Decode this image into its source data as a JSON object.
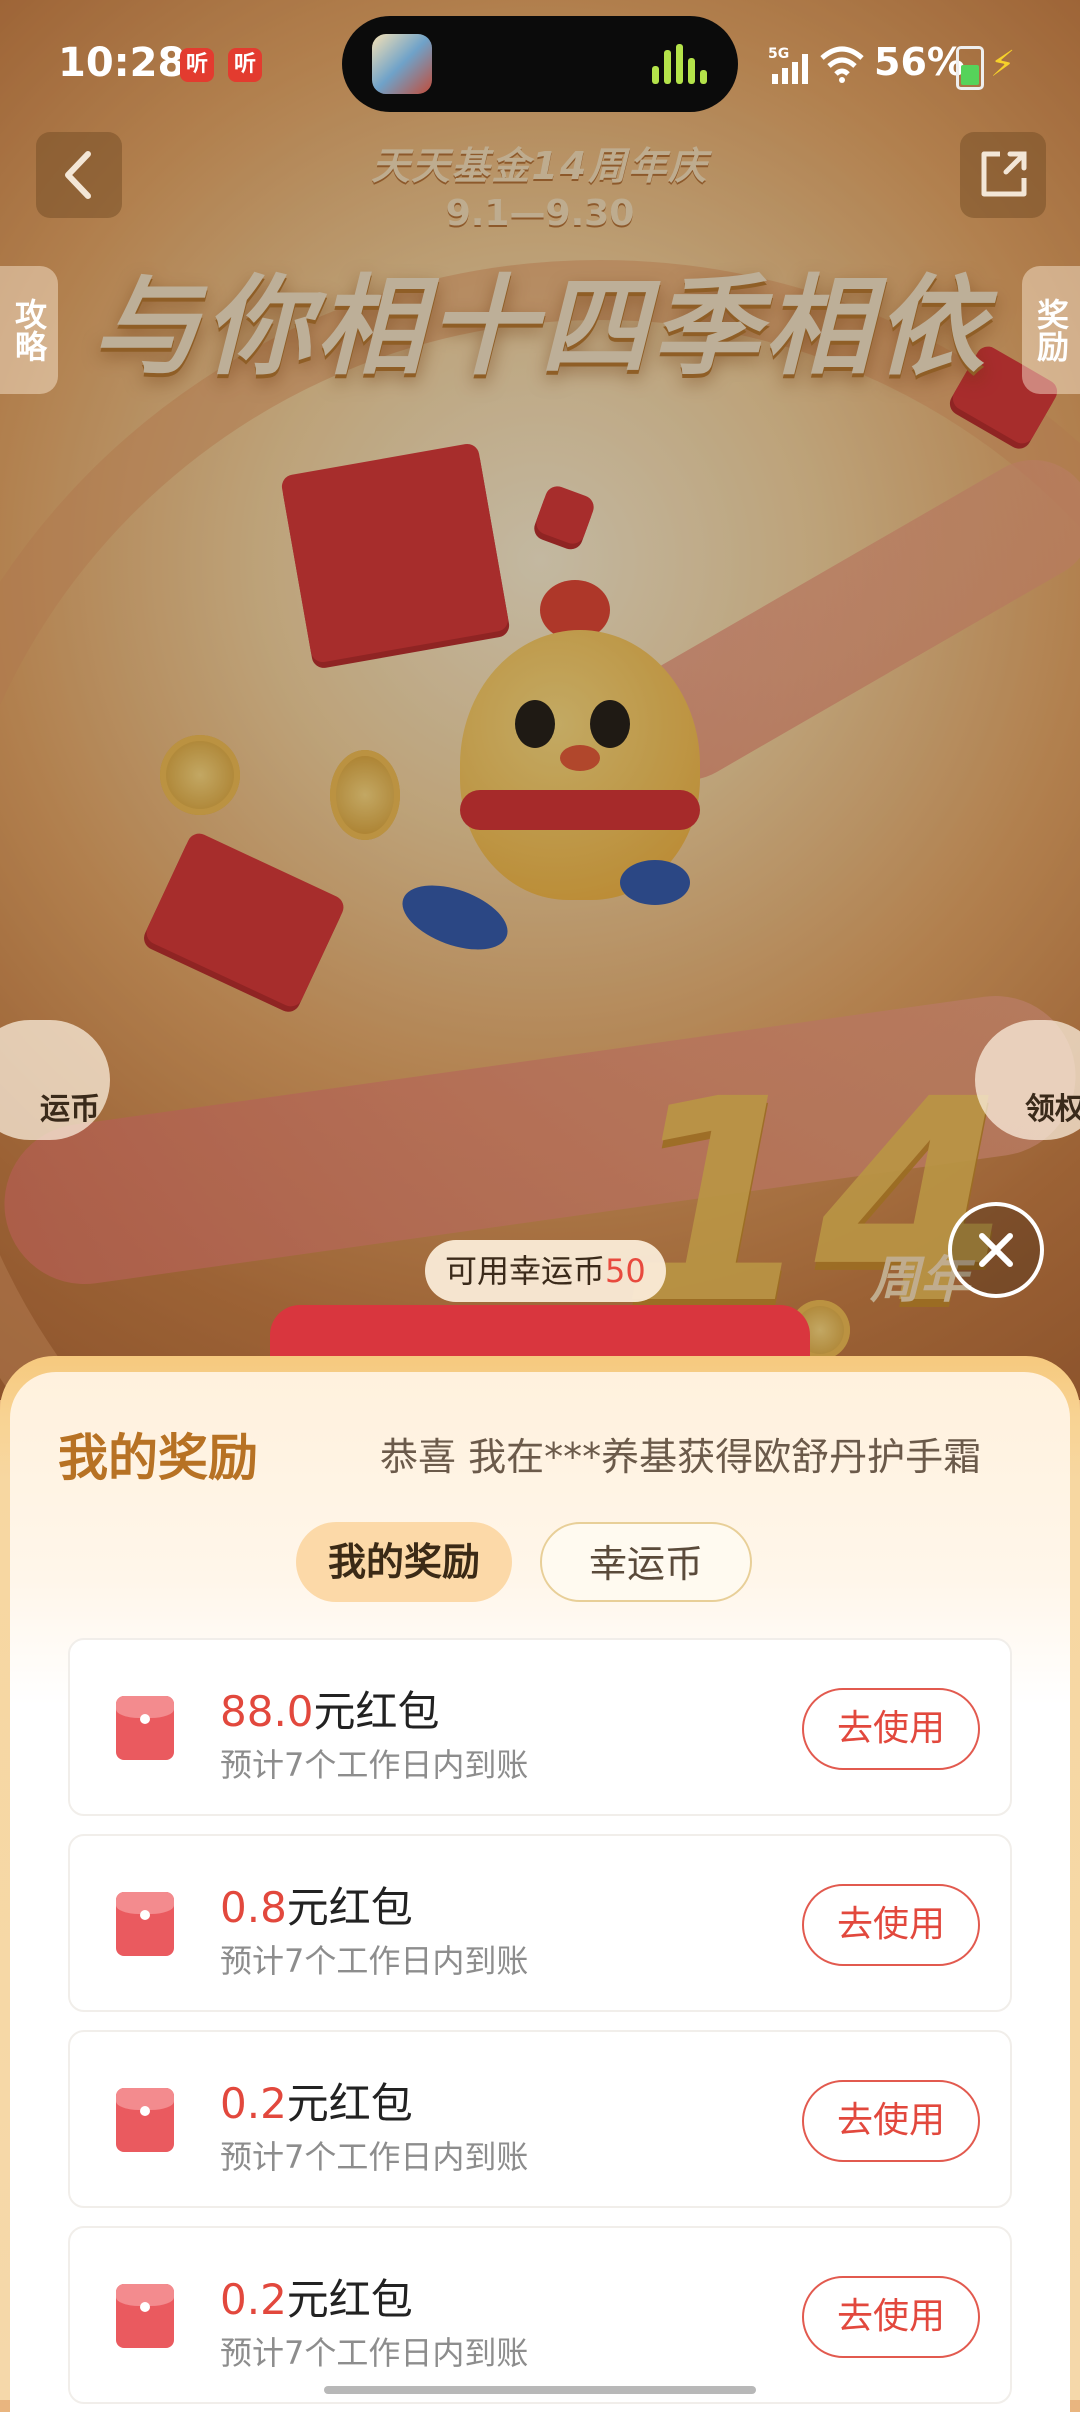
{
  "status_bar": {
    "time": "10:28",
    "tt_badge_1": "听",
    "tt_badge_2": "听",
    "network": "5G",
    "battery": "56%"
  },
  "banner": {
    "event_title": "天天基金14周年庆",
    "date_range": "9.1—9.30",
    "headline": "与你相十四季相依",
    "big_number": "14",
    "anniversary_text": "周年"
  },
  "side": {
    "left_tag": "攻略",
    "right_tag": "奖励",
    "left_pill": "运币",
    "right_pill": "领权"
  },
  "coins": {
    "label": "可用幸运币",
    "value": "50"
  },
  "sheet": {
    "title": "我的奖励",
    "ticker": "恭喜 我在***养基获得欧舒丹护手霜",
    "tabs": [
      {
        "label": "我的奖励",
        "active": true
      },
      {
        "label": "幸运币",
        "active": false
      }
    ],
    "rewards": [
      {
        "amount": "88.0",
        "unit": "元红包",
        "note": "预计7个工作日内到账",
        "button": "去使用"
      },
      {
        "amount": "0.8",
        "unit": "元红包",
        "note": "预计7个工作日内到账",
        "button": "去使用"
      },
      {
        "amount": "0.2",
        "unit": "元红包",
        "note": "预计7个工作日内到账",
        "button": "去使用"
      },
      {
        "amount": "0.2",
        "unit": "元红包",
        "note": "预计7个工作日内到账",
        "button": "去使用"
      }
    ]
  },
  "colors": {
    "accent_red": "#e2483d",
    "title_gold": "#b77224",
    "tab_active_bg": "#fcd9a8"
  }
}
